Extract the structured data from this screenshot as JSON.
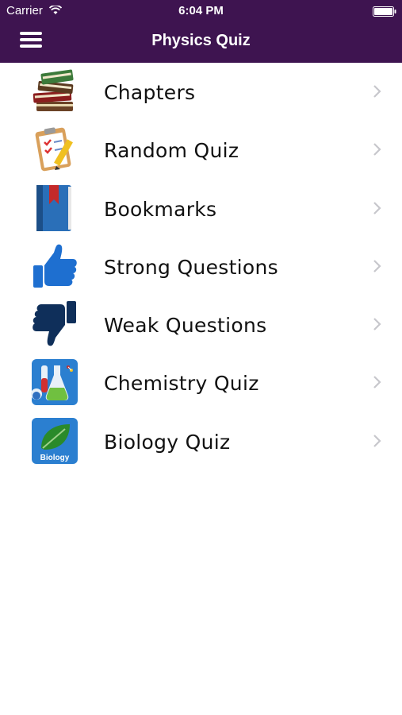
{
  "status": {
    "carrier": "Carrier",
    "time": "6:04 PM"
  },
  "nav": {
    "title": "Physics Quiz"
  },
  "menu": {
    "items": [
      {
        "label": "Chapters",
        "icon": "books-icon"
      },
      {
        "label": "Random Quiz",
        "icon": "clipboard-icon"
      },
      {
        "label": "Bookmarks",
        "icon": "bookmark-book-icon"
      },
      {
        "label": "Strong Questions",
        "icon": "thumbs-up-icon"
      },
      {
        "label": "Weak Questions",
        "icon": "thumbs-down-icon"
      },
      {
        "label": "Chemistry Quiz",
        "icon": "flasks-icon"
      },
      {
        "label": "Biology Quiz",
        "icon": "leaf-icon",
        "badge": "Biology"
      }
    ]
  },
  "colors": {
    "header_bg": "#3e1450",
    "thumb_up": "#1e6fd0",
    "thumb_down": "#0f2f5a",
    "book_blue": "#2a6fb8",
    "accent_red": "#c42a2a"
  }
}
